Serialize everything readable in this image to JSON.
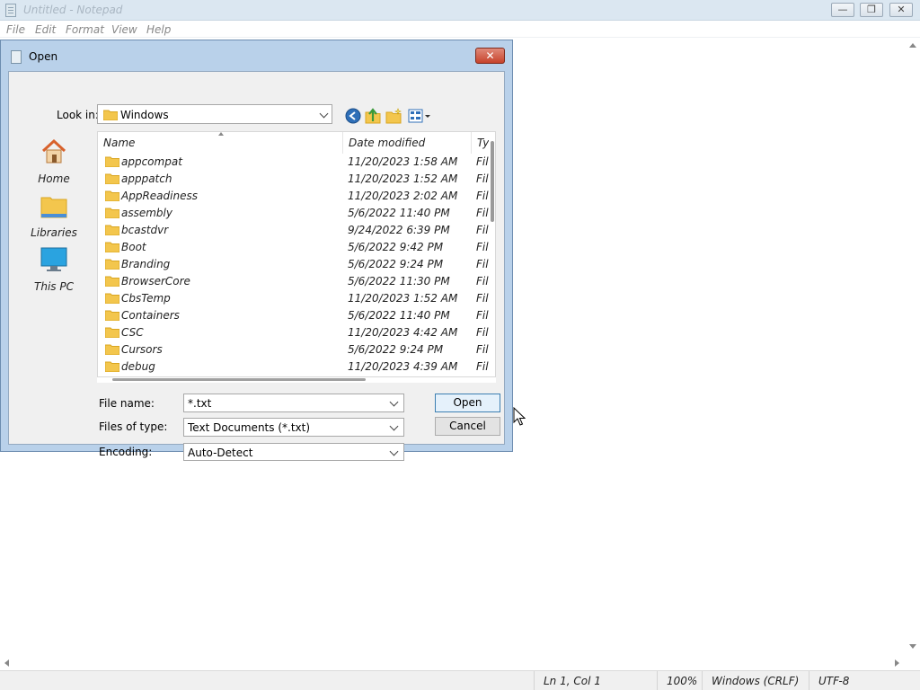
{
  "notepad": {
    "title": "Untitled - Notepad",
    "menu": [
      "File",
      "Edit",
      "Format",
      "View",
      "Help"
    ],
    "window_buttons": {
      "minimize": "—",
      "restore": "❐",
      "close": "✕"
    },
    "statusbar": {
      "position": "Ln 1, Col 1",
      "zoom": "100%",
      "line_endings": "Windows (CRLF)",
      "encoding": "UTF-8"
    }
  },
  "dialog": {
    "title": "Open",
    "close_glyph": "✕",
    "look_in_label": "Look in:",
    "look_in_value": "Windows",
    "places": [
      {
        "label": "Home",
        "icon": "home-icon"
      },
      {
        "label": "Libraries",
        "icon": "libraries-icon"
      },
      {
        "label": "This PC",
        "icon": "this-pc-icon"
      }
    ],
    "columns": {
      "name": "Name",
      "date": "Date modified",
      "type": "Type"
    },
    "files": [
      {
        "name": "appcompat",
        "date": "11/20/2023 1:58 AM",
        "type": "File folder"
      },
      {
        "name": "apppatch",
        "date": "11/20/2023 1:52 AM",
        "type": "File folder"
      },
      {
        "name": "AppReadiness",
        "date": "11/20/2023 2:02 AM",
        "type": "File folder"
      },
      {
        "name": "assembly",
        "date": "5/6/2022 11:40 PM",
        "type": "File folder"
      },
      {
        "name": "bcastdvr",
        "date": "9/24/2022 6:39 PM",
        "type": "File folder"
      },
      {
        "name": "Boot",
        "date": "5/6/2022 9:42 PM",
        "type": "File folder"
      },
      {
        "name": "Branding",
        "date": "5/6/2022 9:24 PM",
        "type": "File folder"
      },
      {
        "name": "BrowserCore",
        "date": "5/6/2022 11:30 PM",
        "type": "File folder"
      },
      {
        "name": "CbsTemp",
        "date": "11/20/2023 1:52 AM",
        "type": "File folder"
      },
      {
        "name": "Containers",
        "date": "5/6/2022 11:40 PM",
        "type": "File folder"
      },
      {
        "name": "CSC",
        "date": "11/20/2023 4:42 AM",
        "type": "File folder"
      },
      {
        "name": "Cursors",
        "date": "5/6/2022 9:24 PM",
        "type": "File folder"
      },
      {
        "name": "debug",
        "date": "11/20/2023 4:39 AM",
        "type": "File folder"
      }
    ],
    "file_name_label": "File name:",
    "file_name_value": "*.txt",
    "files_of_type_label": "Files of type:",
    "files_of_type_value": "Text Documents (*.txt)",
    "encoding_label": "Encoding:",
    "encoding_value": "Auto-Detect",
    "open_label": "Open",
    "cancel_label": "Cancel"
  },
  "colors": {
    "folder": "#f3c64d",
    "folder_dark": "#d9a520",
    "dialog_frame": "#b9d1ea",
    "close_red": "#c7432c",
    "accent_blue": "#3c7fb1"
  }
}
